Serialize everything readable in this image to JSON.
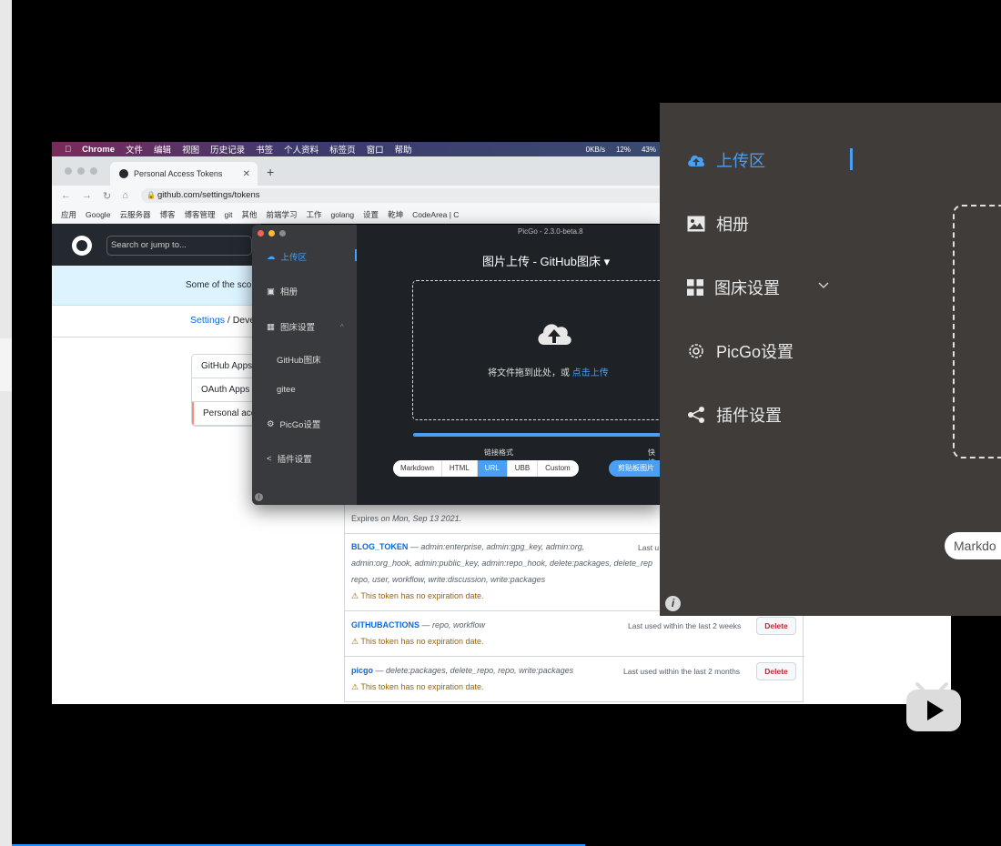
{
  "menubar": {
    "app": "Chrome",
    "items": [
      "文件",
      "编辑",
      "视图",
      "历史记录",
      "书签",
      "个人资料",
      "标签页",
      "窗口",
      "帮助"
    ],
    "status": [
      "0KB/s",
      "12%",
      "43%"
    ]
  },
  "browser": {
    "tab_title": "Personal Access Tokens",
    "url": "github.com/settings/tokens",
    "bookmarks": [
      "应用",
      "Google",
      "云服务器",
      "博客",
      "博客管理",
      "git",
      "其他",
      "前端学习",
      "工作",
      "golang",
      "设置",
      "乾坤",
      "CodeArea | C"
    ]
  },
  "github": {
    "search_placeholder": "Search or jump to...",
    "banner": "Some of the sco",
    "crumb_settings": "Settings",
    "crumb_sep": "/",
    "crumb_rest": "Deve",
    "sidenav": [
      "GitHub Apps",
      "OAuth Apps",
      "Personal acc"
    ],
    "expires_prefix": "Expires ",
    "expires_date": "on Mon, Sep 13 2021.",
    "tokens": [
      {
        "name": "BLOG_TOKEN",
        "scopes": "— admin:enterprise, admin:gpg_key, admin:org,",
        "scopes2": "admin:org_hook, admin:public_key, admin:repo_hook, delete:packages, delete_rep",
        "scopes3": "repo, user, workflow, write:discussion, write:packages",
        "used": "Last u",
        "warning": "This token has no expiration date."
      },
      {
        "name": "GITHUBACTIONS",
        "scopes": "— repo, workflow",
        "used": "Last used within the last 2 weeks",
        "warning": "This token has no expiration date.",
        "delete": "Delete"
      },
      {
        "name": "picgo",
        "scopes": "— delete:packages, delete_repo, repo, write:packages",
        "used": "Last used within the last 2 months",
        "warning": "This token has no expiration date.",
        "delete": "Delete"
      }
    ]
  },
  "picgo_small": {
    "window_title": "PicGo - 2.3.0-beta.8",
    "menu": [
      "上传区",
      "相册",
      "图床设置",
      "GitHub图床",
      "gitee",
      "PicGo设置",
      "插件设置"
    ],
    "title": "图片上传 - GitHub图床 ▾",
    "drop_text": "将文件拖到此处，或 ",
    "drop_link": "点击上传",
    "format_label": "链接格式",
    "quick_label": "快捷",
    "formats": [
      "Markdown",
      "HTML",
      "URL",
      "UBB",
      "Custom"
    ],
    "active_format": "URL",
    "copy_button": "剪贴板图片",
    "accent": "#4a9ff5"
  },
  "picgo_big": {
    "menu": [
      "上传区",
      "相册",
      "图床设置",
      "PicGo设置",
      "插件设置"
    ],
    "format_partial": "Markdo",
    "bg": "#3f3c39"
  }
}
